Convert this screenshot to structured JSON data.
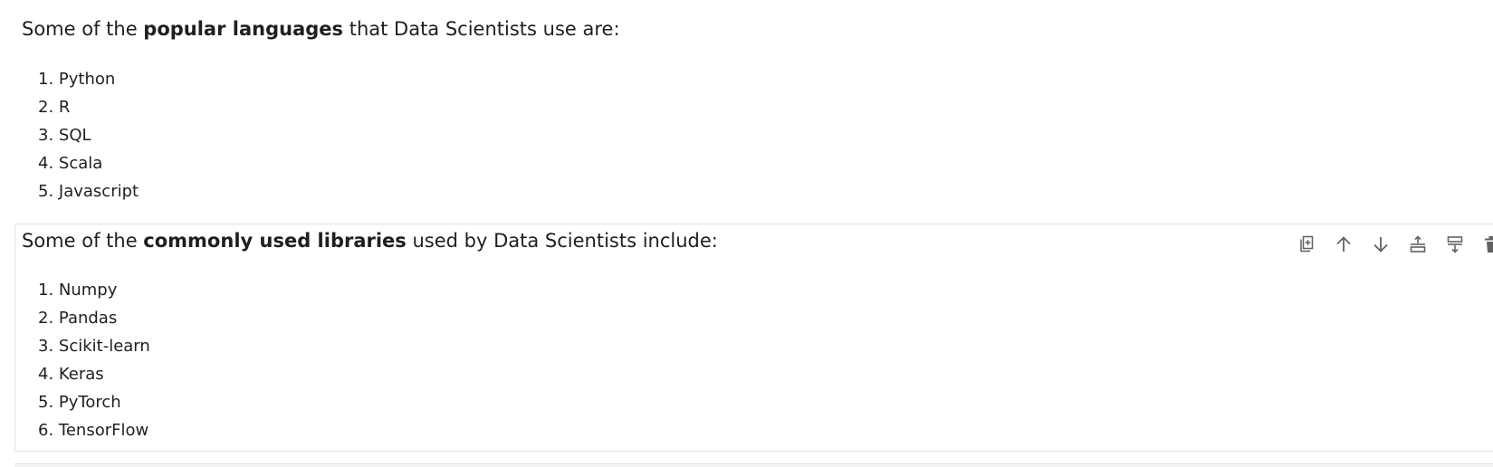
{
  "cells": [
    {
      "intro": {
        "prefix": "Some of the ",
        "bold": "popular languages",
        "suffix": " that Data Scientists use are:"
      },
      "items": [
        "1. Python",
        "2. R",
        "3. SQL",
        "4. Scala",
        "5. Javascript"
      ]
    },
    {
      "intro": {
        "prefix": "Some of the ",
        "bold": "commonly used libraries",
        "suffix": " used by Data Scientists include:"
      },
      "items": [
        "1. Numpy",
        "2. Pandas",
        "3. Scikit-learn",
        "4. Keras",
        "5. PyTorch",
        "6. TensorFlow"
      ]
    }
  ],
  "cell_toolbar": {
    "icons": [
      "duplicate-icon",
      "move-up-icon",
      "move-down-icon",
      "insert-above-icon",
      "insert-below-icon",
      "delete-icon"
    ]
  },
  "colors": {
    "text": "#1f1f1f",
    "cell_border": "#e0e0e0",
    "icon": "#616161"
  }
}
